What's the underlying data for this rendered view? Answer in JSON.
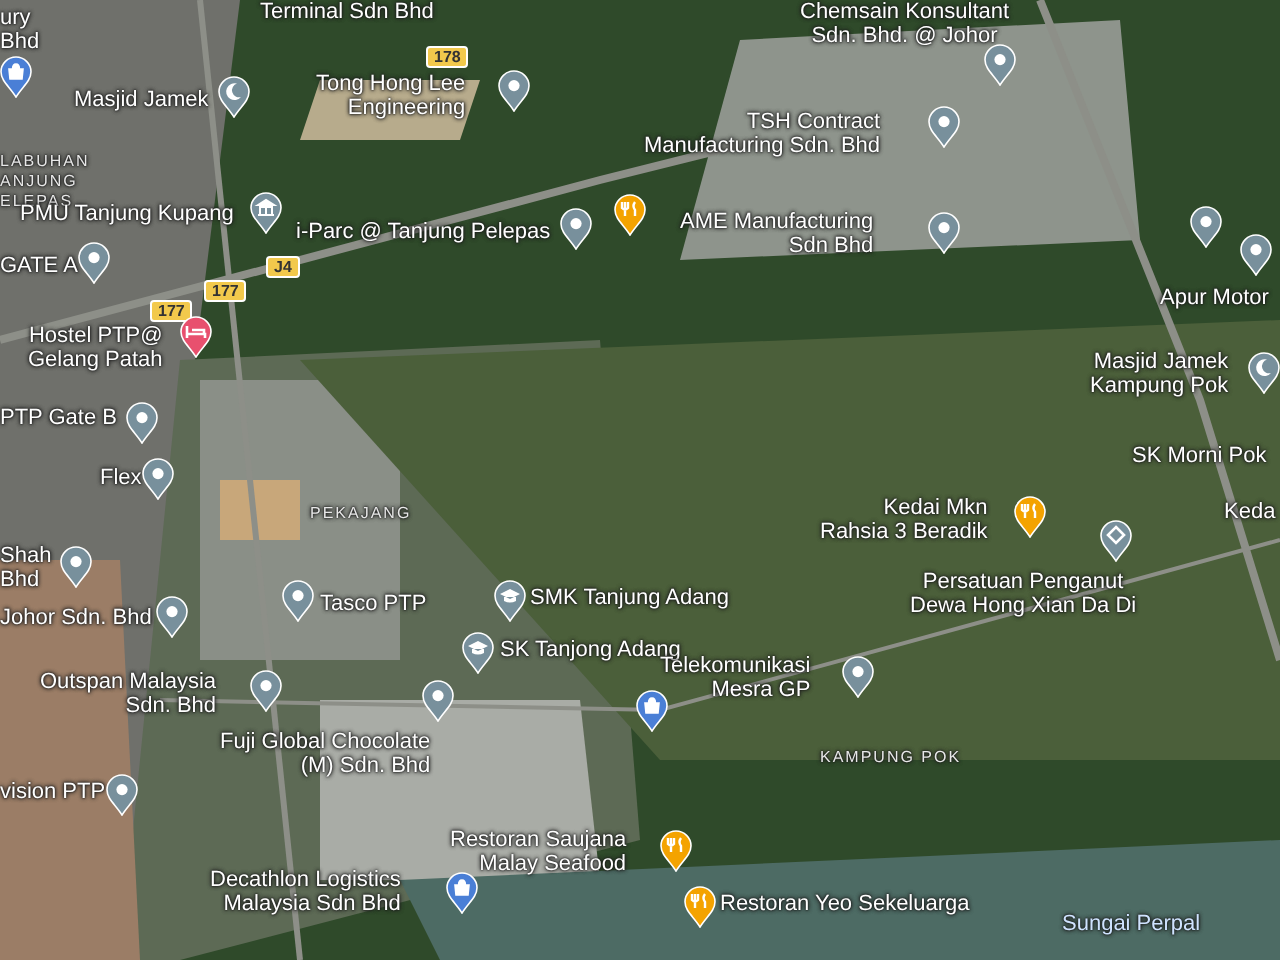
{
  "map": {
    "markers": [
      {
        "kind": "shopping"
      },
      {
        "kind": "mosque"
      },
      {
        "kind": "pin"
      },
      {
        "kind": "government"
      },
      {
        "kind": "pin"
      },
      {
        "kind": "food"
      },
      {
        "kind": "pin"
      },
      {
        "kind": "hotel"
      },
      {
        "kind": "pin"
      },
      {
        "kind": "pin"
      },
      {
        "kind": "pin"
      },
      {
        "kind": "pin"
      },
      {
        "kind": "pin"
      },
      {
        "kind": "pin"
      },
      {
        "kind": "pin"
      },
      {
        "kind": "mosque"
      },
      {
        "kind": "pin"
      },
      {
        "kind": "pin"
      },
      {
        "kind": "pin"
      },
      {
        "kind": "school"
      },
      {
        "kind": "school"
      },
      {
        "kind": "pin"
      },
      {
        "kind": "pin"
      },
      {
        "kind": "pin"
      },
      {
        "kind": "shopping"
      },
      {
        "kind": "food"
      },
      {
        "kind": "temple"
      },
      {
        "kind": "pin"
      },
      {
        "kind": "food"
      },
      {
        "kind": "shopping"
      },
      {
        "kind": "food"
      }
    ],
    "labels": [
      {
        "kind": "place",
        "lines": [
          "Terminal Sdn Bhd"
        ]
      },
      {
        "kind": "place",
        "lines": [
          "ury",
          "Bhd"
        ]
      },
      {
        "kind": "place",
        "lines": [
          "Masjid Jamek"
        ]
      },
      {
        "kind": "place",
        "lines": [
          "Tong Hong Lee",
          "Engineering"
        ]
      },
      {
        "kind": "area",
        "lines": [
          "LABUHAN",
          "ANJUNG",
          "ELEPAS"
        ]
      },
      {
        "kind": "place",
        "lines": [
          "PMU Tanjung Kupang"
        ]
      },
      {
        "kind": "place",
        "lines": [
          "i-Parc @ Tanjung Pelepas"
        ]
      },
      {
        "kind": "place",
        "lines": [
          "GATE A"
        ]
      },
      {
        "kind": "place",
        "lines": [
          "Hostel PTP@",
          "Gelang Patah"
        ]
      },
      {
        "kind": "place",
        "lines": [
          "PTP Gate B"
        ]
      },
      {
        "kind": "place",
        "lines": [
          "Flex"
        ]
      },
      {
        "kind": "place",
        "lines": [
          "Chemsain Konsultant",
          "Sdn. Bhd. @ Johor"
        ]
      },
      {
        "kind": "place",
        "lines": [
          "TSH Contract",
          "Manufacturing Sdn. Bhd"
        ]
      },
      {
        "kind": "place",
        "lines": [
          "AME Manufacturing",
          "Sdn Bhd"
        ]
      },
      {
        "kind": "place",
        "lines": [
          "Apur Motor"
        ]
      },
      {
        "kind": "place",
        "lines": [
          "Masjid Jamek",
          "Kampung Pok"
        ]
      },
      {
        "kind": "place",
        "lines": [
          "SK Morni Pok"
        ]
      },
      {
        "kind": "place",
        "lines": [
          "Kedai Mkn",
          "Rahsia 3 Beradik"
        ]
      },
      {
        "kind": "place",
        "lines": [
          "Keda"
        ]
      },
      {
        "kind": "place",
        "lines": [
          "Persatuan Penganut",
          "Dewa Hong Xian Da Di"
        ]
      },
      {
        "kind": "area",
        "lines": [
          "PEKAJANG"
        ]
      },
      {
        "kind": "place",
        "lines": [
          "Shah",
          "Bhd"
        ]
      },
      {
        "kind": "place",
        "lines": [
          "Johor Sdn. Bhd"
        ]
      },
      {
        "kind": "place",
        "lines": [
          "Tasco PTP"
        ]
      },
      {
        "kind": "place",
        "lines": [
          "SMK Tanjung Adang"
        ]
      },
      {
        "kind": "place",
        "lines": [
          "SK Tanjong Adang"
        ]
      },
      {
        "kind": "place",
        "lines": [
          "Telekomunikasi",
          "Mesra GP"
        ]
      },
      {
        "kind": "place",
        "lines": [
          "Outspan Malaysia",
          "Sdn. Bhd"
        ]
      },
      {
        "kind": "place",
        "lines": [
          "Fuji Global Chocolate",
          "(M) Sdn. Bhd"
        ]
      },
      {
        "kind": "area",
        "lines": [
          "KAMPUNG POK"
        ]
      },
      {
        "kind": "place",
        "lines": [
          "vision PTP"
        ]
      },
      {
        "kind": "place",
        "lines": [
          "Restoran Saujana",
          "Malay Seafood"
        ]
      },
      {
        "kind": "place",
        "lines": [
          "Decathlon Logistics",
          "Malaysia Sdn Bhd"
        ]
      },
      {
        "kind": "place",
        "lines": [
          "Restoran Yeo Sekeluarga"
        ]
      },
      {
        "kind": "water",
        "lines": [
          "Sungai Perpal"
        ]
      }
    ],
    "road_shields": [
      "178",
      "J4",
      "177",
      "177"
    ]
  }
}
